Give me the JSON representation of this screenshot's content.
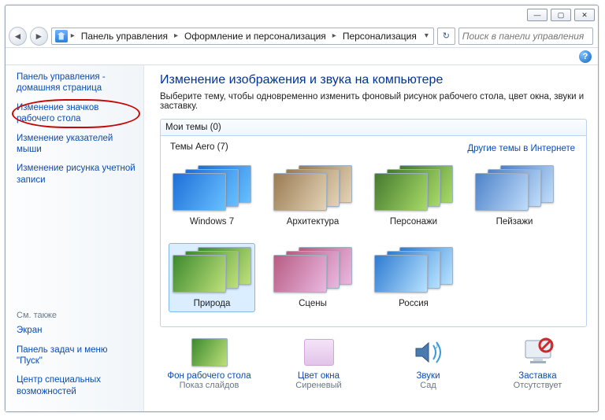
{
  "window": {
    "breadcrumb": [
      "Панель управления",
      "Оформление и персонализация",
      "Персонализация"
    ],
    "search_placeholder": "Поиск в панели управления"
  },
  "sidebar": {
    "items": [
      "Панель управления - домашняя страница",
      "Изменение значков рабочего стола",
      "Изменение указателей мыши",
      "Изменение рисунка учетной записи"
    ],
    "see_also_label": "См. также",
    "see_also": [
      "Экран",
      "Панель задач и меню \"Пуск\"",
      "Центр специальных возможностей"
    ]
  },
  "main": {
    "title": "Изменение изображения и звука на компьютере",
    "subtitle": "Выберите тему, чтобы одновременно изменить фоновый рисунок рабочего стола, цвет окна, звуки и заставку.",
    "mythemes_label": "Мои темы (0)",
    "internet_link": "Другие темы в Интернете",
    "aero_label": "Темы Aero (7)",
    "themes": [
      {
        "name": "Windows 7",
        "cls": "t-win"
      },
      {
        "name": "Архитектура",
        "cls": "t-arch"
      },
      {
        "name": "Персонажи",
        "cls": "t-pers"
      },
      {
        "name": "Пейзажи",
        "cls": "t-land"
      },
      {
        "name": "Природа",
        "cls": "t-nat",
        "selected": true
      },
      {
        "name": "Сцены",
        "cls": "t-scn"
      },
      {
        "name": "Россия",
        "cls": "t-rus"
      }
    ],
    "bottom": {
      "background": {
        "label": "Фон рабочего стола",
        "value": "Показ слайдов"
      },
      "color": {
        "label": "Цвет окна",
        "value": "Сиреневый"
      },
      "sounds": {
        "label": "Звуки",
        "value": "Сад"
      },
      "saver": {
        "label": "Заставка",
        "value": "Отсутствует"
      }
    }
  }
}
